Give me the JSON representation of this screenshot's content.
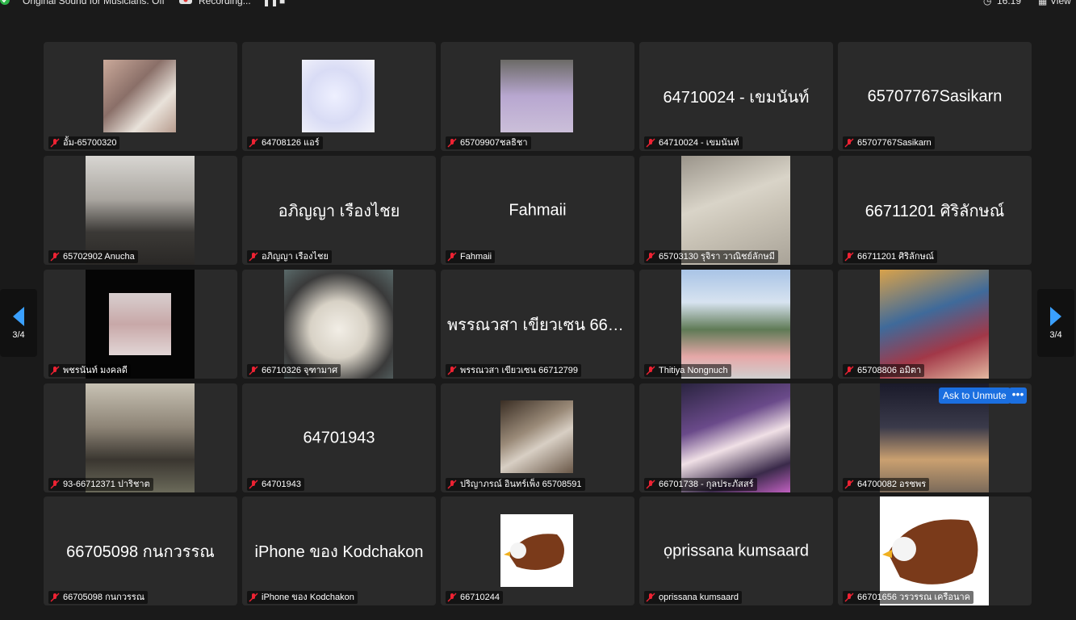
{
  "topbar": {
    "original_sound": "Original Sound for Musicians: Off",
    "recording": "Recording...",
    "time": "16:19",
    "view": "View"
  },
  "nav": {
    "page_left": "3/4",
    "page_right": "3/4"
  },
  "popup": {
    "ask_to_unmute": "Ask to Unmute",
    "more": "•••"
  },
  "tiles": [
    {
      "label": "อั้ม-65700320"
    },
    {
      "label": "64708126 แอร์"
    },
    {
      "label": "65709907ชลธิชา"
    },
    {
      "label": "64710024 - เขมนันท์",
      "big": "64710024 - เขมนันท์"
    },
    {
      "label": "65707767Sasikarn",
      "big": "65707767Sasikarn"
    },
    {
      "label": "65702902 Anucha"
    },
    {
      "label": "อภิญญา เรืองไชย",
      "big": "อภิญญา เรืองไชย"
    },
    {
      "label": "Fahmaii",
      "big": "Fahmaii"
    },
    {
      "label": "65703130 รุจิรา วาณิชย์ลักษมี"
    },
    {
      "label": "66711201 ศิริลักษณ์",
      "big": "66711201 ศิริลักษณ์"
    },
    {
      "label": "พชรนันท์ มงคลดี"
    },
    {
      "label": "66710326 จุฑามาศ"
    },
    {
      "label": "พรรณวสา เขียวเซน 66712799",
      "big": "พรรณวสา เขียวเซน 6671..."
    },
    {
      "label": "Thitiya Nongnuch"
    },
    {
      "label": "65708806 อมิตา"
    },
    {
      "label": "93-66712371 ปาริชาต"
    },
    {
      "label": "64701943",
      "big": "64701943"
    },
    {
      "label": "ปริญาภรณ์ อินทร์เพ็ง 65708591"
    },
    {
      "label": "66701738 - กุลประภัสสร์"
    },
    {
      "label": "64700082 อรชพร"
    },
    {
      "label": "66705098 กนกวรรณ",
      "big": "66705098 กนกวรรณ"
    },
    {
      "label": "iPhone ของ Kodchakon",
      "big": "iPhone ของ Kodchakon"
    },
    {
      "label": "66710244"
    },
    {
      "label": "ọprissana kumsaard",
      "big": "ọprissana kumsaard"
    },
    {
      "label": "66701656 วรวรรณ เครือนาค"
    }
  ]
}
